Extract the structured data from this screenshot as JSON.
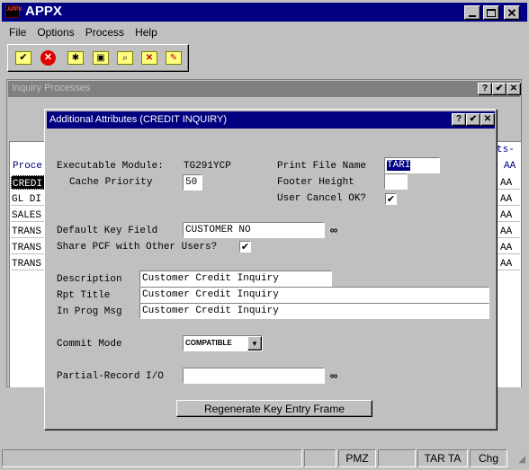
{
  "app": {
    "title": "APPX",
    "logo_text": "APPX"
  },
  "menu": [
    "File",
    "Options",
    "Process",
    "Help"
  ],
  "toolbar_icons": [
    "check-edit-icon",
    "cancel-icon",
    "new-record-icon",
    "open-folder-icon",
    "find-icon",
    "delete-record-icon",
    "edit-record-icon"
  ],
  "inquiry": {
    "title": "Inquiry Processes",
    "col_left": "Proce",
    "col_right_top": "ts-",
    "col_right": "AA",
    "rows": [
      {
        "name": "CREDI",
        "code": "AA",
        "selected": true
      },
      {
        "name": "GL DI",
        "code": "AA",
        "selected": false
      },
      {
        "name": "SALES",
        "code": "AA",
        "selected": false
      },
      {
        "name": "TRANS",
        "code": "AA",
        "selected": false
      },
      {
        "name": "TRANS",
        "code": "AA",
        "selected": false
      },
      {
        "name": "TRANS",
        "code": "AA",
        "selected": false
      }
    ]
  },
  "dialog": {
    "title": "Additional Attributes (CREDIT INQUIRY)",
    "exec_module_label": "Executable Module:",
    "exec_module_value": "TG291YCP",
    "cache_priority_label": "Cache Priority",
    "cache_priority_value": "50",
    "print_file_label": "Print File Name",
    "print_file_value": "TARI",
    "footer_height_label": "Footer Height",
    "footer_height_value": "",
    "user_cancel_label": "User Cancel OK?",
    "user_cancel_checked": true,
    "default_key_label": "Default Key Field",
    "default_key_value": "CUSTOMER NO",
    "share_pcf_label": "Share PCF with Other Users?",
    "share_pcf_checked": true,
    "description_label": "Description",
    "description_value": "Customer Credit Inquiry",
    "rpt_title_label": "Rpt Title",
    "rpt_title_value": "Customer Credit Inquiry",
    "in_prog_label": "In Prog Msg",
    "in_prog_value": "Customer Credit Inquiry",
    "commit_mode_label": "Commit Mode",
    "commit_mode_value": "COMPATIBLE",
    "partial_record_label": "Partial-Record I/O",
    "partial_record_value": "",
    "regen_button": "Regenerate Key Entry Frame"
  },
  "status": {
    "s1": "",
    "s2": "",
    "pmz": "PMZ",
    "s4": "",
    "tar": "TAR TA",
    "chg": "Chg"
  },
  "colors": {
    "titlebar": "#000080",
    "window_bg": "#c0c0c0",
    "inquiry_title": "#808080"
  }
}
